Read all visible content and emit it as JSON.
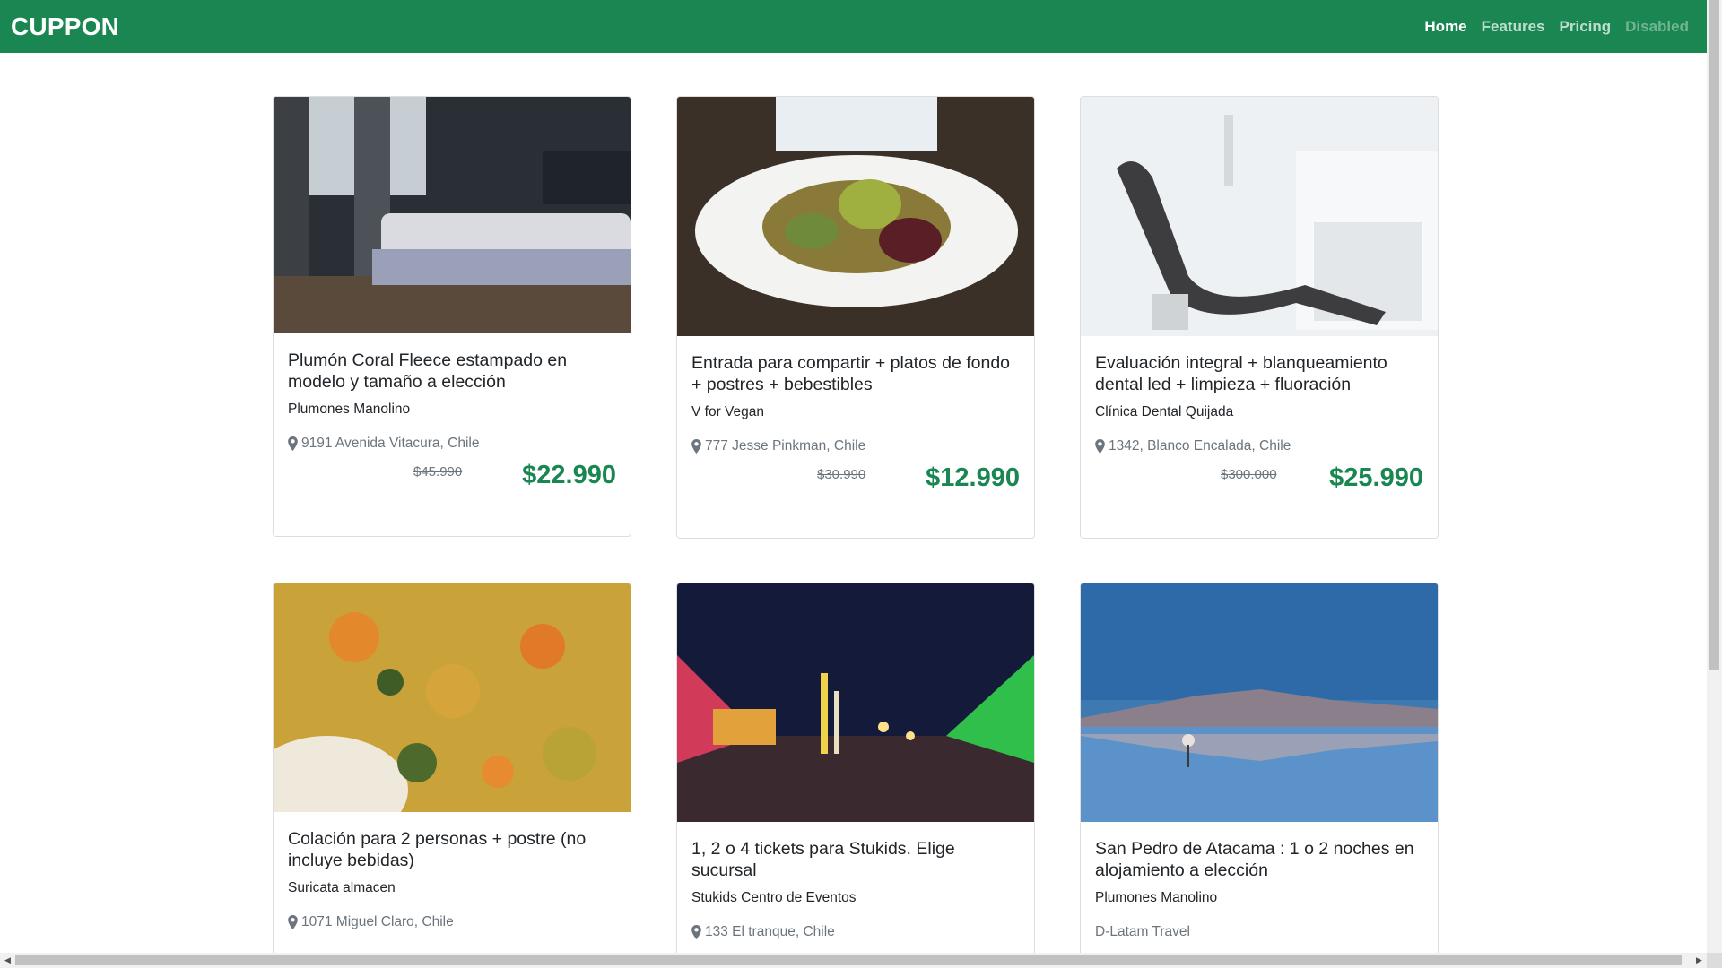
{
  "navbar": {
    "brand": "CUPPON",
    "links": [
      {
        "label": "Home",
        "state": "active"
      },
      {
        "label": "Features",
        "state": "normal"
      },
      {
        "label": "Pricing",
        "state": "normal"
      },
      {
        "label": "Disabled",
        "state": "disabled"
      }
    ]
  },
  "colors": {
    "brand_green": "#1a8752",
    "muted": "#6c757d"
  },
  "deals": [
    {
      "image": "bedroom-photo",
      "title": "Plumón Coral Fleece estampado en modelo y tamaño a elección",
      "vendor": "Plumones Manolino",
      "location": "9191 Avenida Vitacura, Chile",
      "old_price": "$45.990",
      "price": "$22.990"
    },
    {
      "image": "vegan-salad-photo",
      "title": "Entrada para compartir + platos de fondo + postres + bebestibles",
      "vendor": "V for Vegan",
      "location": "777 Jesse Pinkman, Chile",
      "old_price": "$30.990",
      "price": "$12.990"
    },
    {
      "image": "dental-chair-photo",
      "title": "Evaluación integral + blanqueamiento dental led + limpieza + fluoración",
      "vendor": "Clínica Dental Quijada",
      "location": "1342, Blanco Encalada, Chile",
      "old_price": "$300.000",
      "price": "$25.990"
    },
    {
      "image": "food-dish-photo",
      "title": "Colación para 2 personas + postre (no incluye bebidas)",
      "vendor": "Suricata almacen",
      "location": "1071 Miguel Claro, Chile",
      "old_price": "",
      "price": ""
    },
    {
      "image": "carnival-photo",
      "title": "1, 2 o 4 tickets para Stukids. Elige sucursal",
      "vendor": "Stukids Centro de Eventos",
      "location": "133 El tranque, Chile",
      "old_price": "",
      "price": ""
    },
    {
      "image": "flamingo-lake-photo",
      "title": "San Pedro de Atacama : 1 o 2 noches en alojamiento a elección",
      "vendor": "Plumones Manolino",
      "location": "D-Latam Travel",
      "old_price": "",
      "price": ""
    }
  ]
}
